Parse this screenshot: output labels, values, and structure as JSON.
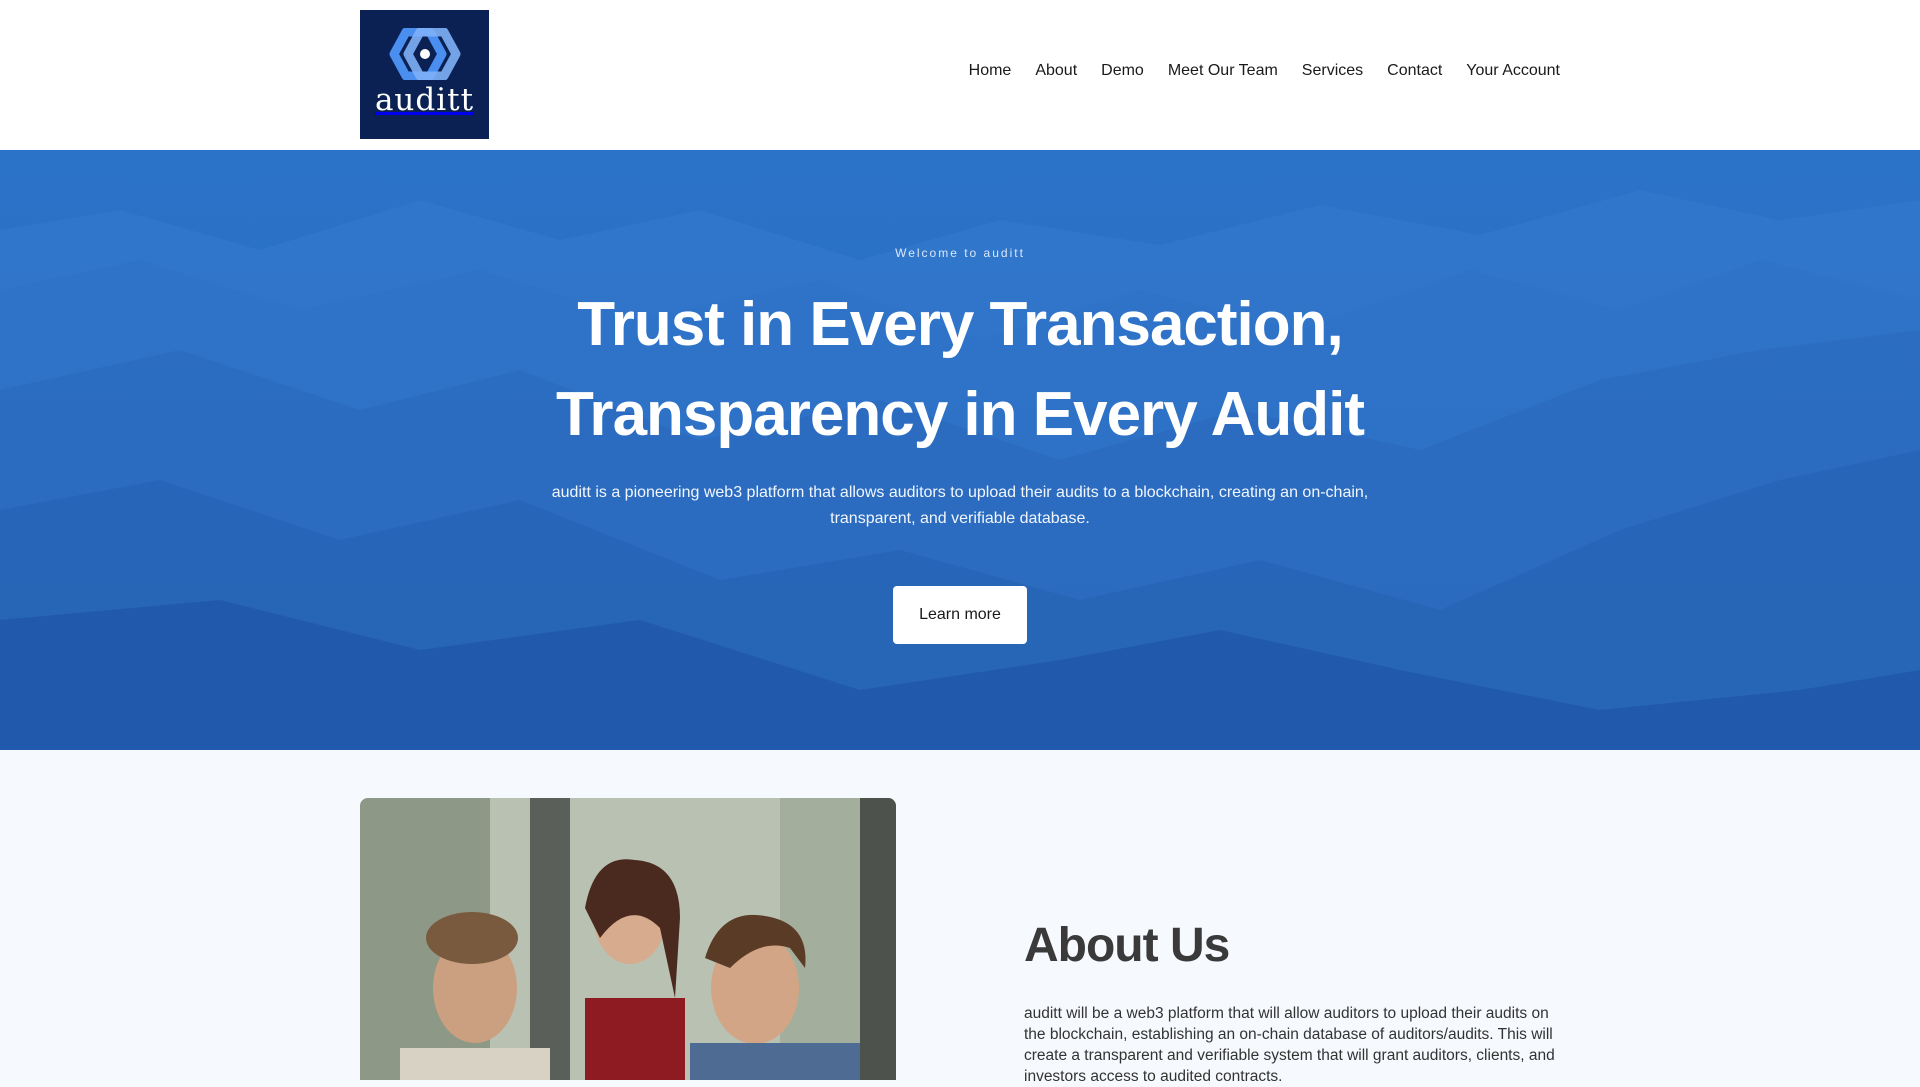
{
  "brand": {
    "name": "auditt"
  },
  "nav": {
    "items": [
      "Home",
      "About",
      "Demo",
      "Meet Our Team",
      "Services",
      "Contact",
      "Your Account"
    ]
  },
  "hero": {
    "eyebrow": "Welcome to auditt",
    "headline_line1": "Trust in Every Transaction,",
    "headline_line2": "Transparency in Every Audit",
    "subtext": "auditt is a pioneering web3 platform that allows auditors to upload their audits to a blockchain, creating an on-chain, transparent, and verifiable database.",
    "cta_label": "Learn more"
  },
  "about": {
    "title": "About Us",
    "text": "auditt will be a web3 platform that will allow auditors to upload their audits on the blockchain, establishing an on-chain database of auditors/audits. This will create a transparent and verifiable system that will grant auditors, clients, and investors access to audited contracts."
  },
  "colors": {
    "hero_blue": "#2b73c8",
    "logo_navy": "#0c2153",
    "logo_accent": "#4a8ef0"
  },
  "icons": {
    "logo": "auditt-hexagon-logo-icon"
  }
}
